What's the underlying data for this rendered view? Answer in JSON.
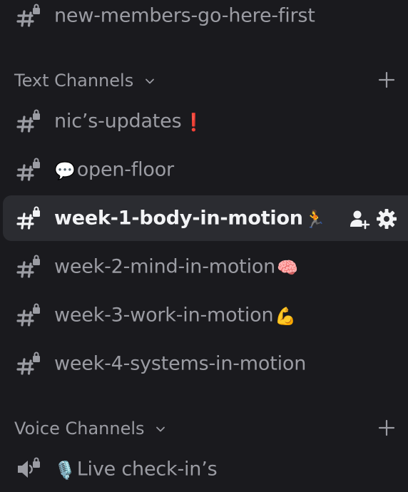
{
  "top_channel": {
    "label": "new-members-go-here-first",
    "icon": "locked-hash-icon"
  },
  "text_category": {
    "label": "Text Channels",
    "chevron_icon": "chevron-down-icon",
    "add_icon": "plus-icon"
  },
  "text_channels": [
    {
      "label": "nic’s-updates",
      "emoji_after": "❗",
      "emoji_before": "",
      "active": false
    },
    {
      "label": "open-floor",
      "emoji_before": "💬",
      "emoji_after": "",
      "active": false
    },
    {
      "label": "week-1-body-in-motion",
      "emoji_after": "🏃",
      "emoji_before": "",
      "active": true
    },
    {
      "label": "week-2-mind-in-motion",
      "emoji_after": "🧠",
      "emoji_before": "",
      "active": false
    },
    {
      "label": "week-3-work-in-motion",
      "emoji_after": "💪",
      "emoji_before": "",
      "active": false
    },
    {
      "label": "week-4-systems-in-motion",
      "emoji_after": "",
      "emoji_before": "",
      "active": false
    }
  ],
  "active_channel_actions": {
    "invite_icon": "add-member-icon",
    "settings_icon": "gear-icon"
  },
  "voice_category": {
    "label": "Voice Channels",
    "chevron_icon": "chevron-down-icon",
    "add_icon": "plus-icon"
  },
  "voice_channels": [
    {
      "label": "Live check-in’s",
      "emoji_before": "🎙️",
      "icon": "locked-speaker-icon"
    }
  ],
  "colors": {
    "background": "#1a1a1e",
    "active_row": "#2b2c31",
    "muted_text": "#9b9ca3",
    "active_text": "#f2f3f5",
    "alert_red": "#e0281e"
  }
}
